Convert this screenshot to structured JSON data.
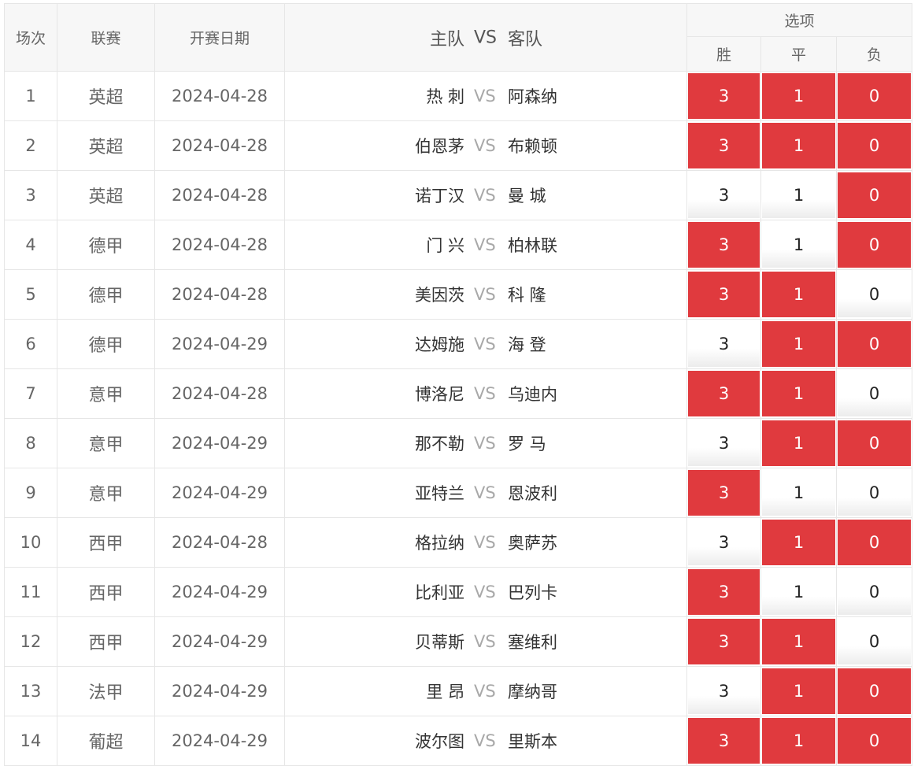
{
  "header": {
    "round": "场次",
    "league": "联赛",
    "date": "开赛日期",
    "home": "主队",
    "vs": "VS",
    "away": "客队",
    "options": "选项",
    "win": "胜",
    "draw": "平",
    "lose": "负"
  },
  "colors": {
    "selected": "#e03a3e",
    "unselected": "#f5f5f5"
  },
  "matches": [
    {
      "no": "1",
      "league": "英超",
      "date": "2024-04-28",
      "home": "热 刺",
      "vs": "VS",
      "away": "阿森纳",
      "w": "3",
      "d": "1",
      "l": "0",
      "sel": [
        true,
        true,
        true
      ]
    },
    {
      "no": "2",
      "league": "英超",
      "date": "2024-04-28",
      "home": "伯恩茅",
      "vs": "VS",
      "away": "布赖顿",
      "w": "3",
      "d": "1",
      "l": "0",
      "sel": [
        true,
        true,
        true
      ]
    },
    {
      "no": "3",
      "league": "英超",
      "date": "2024-04-28",
      "home": "诺丁汉",
      "vs": "VS",
      "away": "曼 城",
      "w": "3",
      "d": "1",
      "l": "0",
      "sel": [
        false,
        false,
        true
      ]
    },
    {
      "no": "4",
      "league": "德甲",
      "date": "2024-04-28",
      "home": "门 兴",
      "vs": "VS",
      "away": "柏林联",
      "w": "3",
      "d": "1",
      "l": "0",
      "sel": [
        true,
        false,
        true
      ]
    },
    {
      "no": "5",
      "league": "德甲",
      "date": "2024-04-28",
      "home": "美因茨",
      "vs": "VS",
      "away": "科 隆",
      "w": "3",
      "d": "1",
      "l": "0",
      "sel": [
        true,
        true,
        false
      ]
    },
    {
      "no": "6",
      "league": "德甲",
      "date": "2024-04-29",
      "home": "达姆施",
      "vs": "VS",
      "away": "海 登",
      "w": "3",
      "d": "1",
      "l": "0",
      "sel": [
        false,
        true,
        true
      ]
    },
    {
      "no": "7",
      "league": "意甲",
      "date": "2024-04-28",
      "home": "博洛尼",
      "vs": "VS",
      "away": "乌迪内",
      "w": "3",
      "d": "1",
      "l": "0",
      "sel": [
        true,
        true,
        false
      ]
    },
    {
      "no": "8",
      "league": "意甲",
      "date": "2024-04-29",
      "home": "那不勒",
      "vs": "VS",
      "away": "罗 马",
      "w": "3",
      "d": "1",
      "l": "0",
      "sel": [
        false,
        true,
        true
      ]
    },
    {
      "no": "9",
      "league": "意甲",
      "date": "2024-04-29",
      "home": "亚特兰",
      "vs": "VS",
      "away": "恩波利",
      "w": "3",
      "d": "1",
      "l": "0",
      "sel": [
        true,
        false,
        false
      ]
    },
    {
      "no": "10",
      "league": "西甲",
      "date": "2024-04-28",
      "home": "格拉纳",
      "vs": "VS",
      "away": "奥萨苏",
      "w": "3",
      "d": "1",
      "l": "0",
      "sel": [
        false,
        true,
        true
      ]
    },
    {
      "no": "11",
      "league": "西甲",
      "date": "2024-04-29",
      "home": "比利亚",
      "vs": "VS",
      "away": "巴列卡",
      "w": "3",
      "d": "1",
      "l": "0",
      "sel": [
        true,
        false,
        false
      ]
    },
    {
      "no": "12",
      "league": "西甲",
      "date": "2024-04-29",
      "home": "贝蒂斯",
      "vs": "VS",
      "away": "塞维利",
      "w": "3",
      "d": "1",
      "l": "0",
      "sel": [
        true,
        true,
        false
      ]
    },
    {
      "no": "13",
      "league": "法甲",
      "date": "2024-04-29",
      "home": "里 昂",
      "vs": "VS",
      "away": "摩纳哥",
      "w": "3",
      "d": "1",
      "l": "0",
      "sel": [
        false,
        true,
        true
      ]
    },
    {
      "no": "14",
      "league": "葡超",
      "date": "2024-04-29",
      "home": "波尔图",
      "vs": "VS",
      "away": "里斯本",
      "w": "3",
      "d": "1",
      "l": "0",
      "sel": [
        true,
        true,
        true
      ]
    }
  ]
}
